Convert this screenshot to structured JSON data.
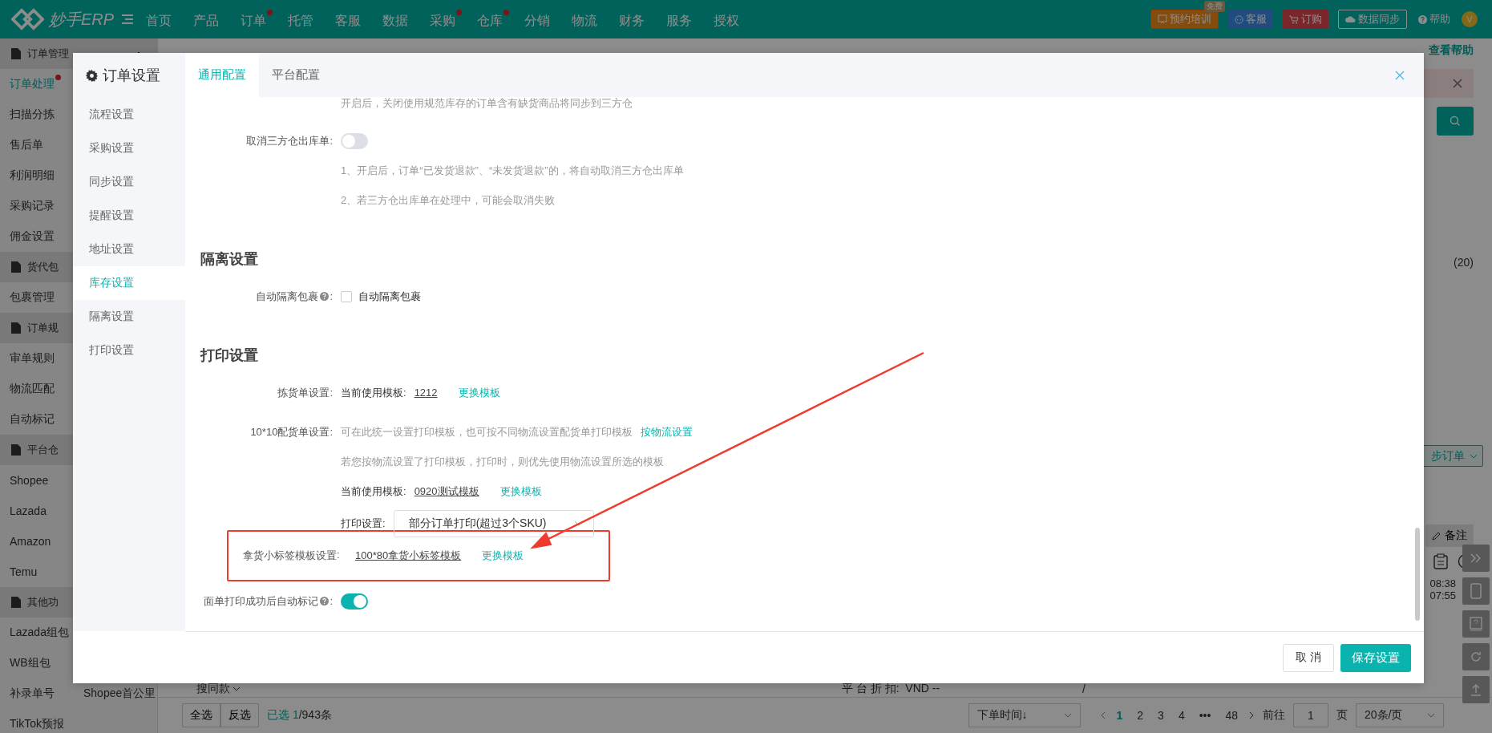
{
  "topbar": {
    "brand": "妙手ERP",
    "nav": [
      {
        "label": "首页",
        "dot": false
      },
      {
        "label": "产品",
        "dot": false
      },
      {
        "label": "订单",
        "dot": true
      },
      {
        "label": "托管",
        "dot": false
      },
      {
        "label": "客服",
        "dot": false
      },
      {
        "label": "数据",
        "dot": false
      },
      {
        "label": "采购",
        "dot": true
      },
      {
        "label": "仓库",
        "dot": true
      },
      {
        "label": "分销",
        "dot": false
      },
      {
        "label": "物流",
        "dot": false
      },
      {
        "label": "财务",
        "dot": false
      },
      {
        "label": "服务",
        "dot": false
      },
      {
        "label": "授权",
        "dot": false
      }
    ],
    "actions": [
      {
        "kind": "training",
        "label": "预约培训",
        "badge": "免费"
      },
      {
        "kind": "service",
        "label": "客服"
      },
      {
        "kind": "order",
        "label": "订购"
      },
      {
        "kind": "sync",
        "label": "数据同步"
      },
      {
        "kind": "help",
        "label": "帮助"
      }
    ],
    "avatar": "V"
  },
  "sidebar": {
    "groups": [
      {
        "title": "订单管理",
        "expanded": true,
        "items": [
          {
            "label": "订单处理",
            "selected": true,
            "dot": true
          },
          {
            "label": "扫描分拣",
            "selected": false,
            "dot": false
          },
          {
            "label": "售后单",
            "selected": false,
            "dot": false
          },
          {
            "label": "利润明细",
            "selected": false,
            "dot": false
          },
          {
            "label": "采购记录",
            "selected": false,
            "dot": false
          },
          {
            "label": "佣金设置",
            "selected": false,
            "dot": false
          }
        ]
      },
      {
        "title": "货代包",
        "items": [
          {
            "label": "包裹管理",
            "selected": false,
            "dot": false
          }
        ]
      },
      {
        "title": "订单规",
        "items": [
          {
            "label": "审单规则",
            "selected": false,
            "dot": false
          },
          {
            "label": "物流匹配",
            "selected": false,
            "dot": false
          },
          {
            "label": "自动标记",
            "selected": false,
            "dot": false
          }
        ]
      },
      {
        "title": "平台仓",
        "items": [
          {
            "label": "Shopee",
            "selected": false,
            "dot": false
          },
          {
            "label": "Lazada",
            "selected": false,
            "dot": false
          },
          {
            "label": "Amazon",
            "selected": false,
            "dot": false
          },
          {
            "label": "Temu",
            "selected": false,
            "dot": false
          }
        ]
      },
      {
        "title": "其他功",
        "items": [
          {
            "label": "Lazada组包",
            "selected": false,
            "dot": false
          },
          {
            "label": "WB组包",
            "selected": false,
            "dot": false
          },
          {
            "label": "补录单号",
            "selected": false,
            "dot": false,
            "side_item": "Shopee首公里"
          },
          {
            "label": "TikTok预报",
            "selected": false,
            "dot": false
          }
        ]
      }
    ]
  },
  "main": {
    "help_link": "查看帮助",
    "count": "(20)",
    "sync_button": "步订单",
    "remark_button": "备注",
    "times": [
      "08:38",
      "07:55"
    ],
    "search_similar": "搜同款",
    "discount": "平 台 折 扣:  VND --",
    "column_text": "/"
  },
  "footer": {
    "select_all": "全选",
    "invert": "反选",
    "selected": "已选 1",
    "total": "/943条",
    "sort": "下单时间↓",
    "pages": [
      {
        "label": "1",
        "selected": true
      },
      {
        "label": "2",
        "selected": false
      },
      {
        "label": "3",
        "selected": false
      },
      {
        "label": "4",
        "selected": false
      },
      {
        "label": "•••",
        "selected": false
      },
      {
        "label": "48",
        "selected": false
      }
    ],
    "goto_label": "前往",
    "goto_value": "1",
    "page_unit": "页",
    "page_size": "20条/页"
  },
  "modal": {
    "title": "订单设置",
    "nav": [
      {
        "label": "流程设置",
        "selected": false
      },
      {
        "label": "采购设置",
        "selected": false
      },
      {
        "label": "同步设置",
        "selected": false
      },
      {
        "label": "提醒设置",
        "selected": false
      },
      {
        "label": "地址设置",
        "selected": false
      },
      {
        "label": "库存设置",
        "selected": true
      },
      {
        "label": "隔离设置",
        "selected": false
      },
      {
        "label": "打印设置",
        "selected": false
      }
    ],
    "tabs": [
      {
        "label": "通用配置",
        "selected": true
      },
      {
        "label": "平台配置",
        "selected": false
      }
    ],
    "rows": [
      {
        "kind": "hint",
        "text": "开启后，关闭使用规范库存的订单含有缺货商品将同步到三方仓"
      },
      {
        "kind": "switch",
        "label": "取消三方仓出库单",
        "suffix": ":",
        "on": false
      },
      {
        "kind": "hint",
        "text": "1、开启后，订单“已发货退款”、“未发货退款”的，将自动取消三方仓出库单"
      },
      {
        "kind": "hint",
        "text": "2、若三方仓出库单在处理中，可能会取消失败"
      },
      {
        "kind": "section",
        "text": "隔离设置"
      },
      {
        "kind": "checkbox",
        "label": "自动隔离包裹",
        "suffix": ":",
        "help": true,
        "checked": false,
        "text": "自动隔离包裹"
      },
      {
        "kind": "section",
        "text": "打印设置"
      },
      {
        "kind": "template",
        "label": "拣货单设置",
        "suffix": ":",
        "prefix": "当前使用模板:",
        "template": "1212",
        "action": "更换模板",
        "highlighted": false
      },
      {
        "kind": "note",
        "label": "10*10配货单设置",
        "suffix": ":",
        "text": "可在此统一设置打印模板，也可按不同物流设置配货单打印模板",
        "link": "按物流设置"
      },
      {
        "kind": "hint",
        "text": "若您按物流设置了打印模板，打印时，则优先使用物流设置所选的模板"
      },
      {
        "kind": "template",
        "prefix": "当前使用模板:",
        "template": "0920测试模板",
        "action": "更换模板",
        "highlighted": false
      },
      {
        "kind": "select",
        "prefix": "打印设置:",
        "value": "部分订单打印(超过3个SKU)"
      },
      {
        "kind": "template",
        "label": "拿货小标签模板设置",
        "suffix": ":",
        "template": "100*80拿货小标签模板",
        "action": "更换模板",
        "highlighted": true
      },
      {
        "kind": "switch",
        "label": "面单打印成功后自动标记",
        "suffix": ":",
        "help": true,
        "on": true
      }
    ],
    "cancel": "取 消",
    "save": "保存设置"
  }
}
